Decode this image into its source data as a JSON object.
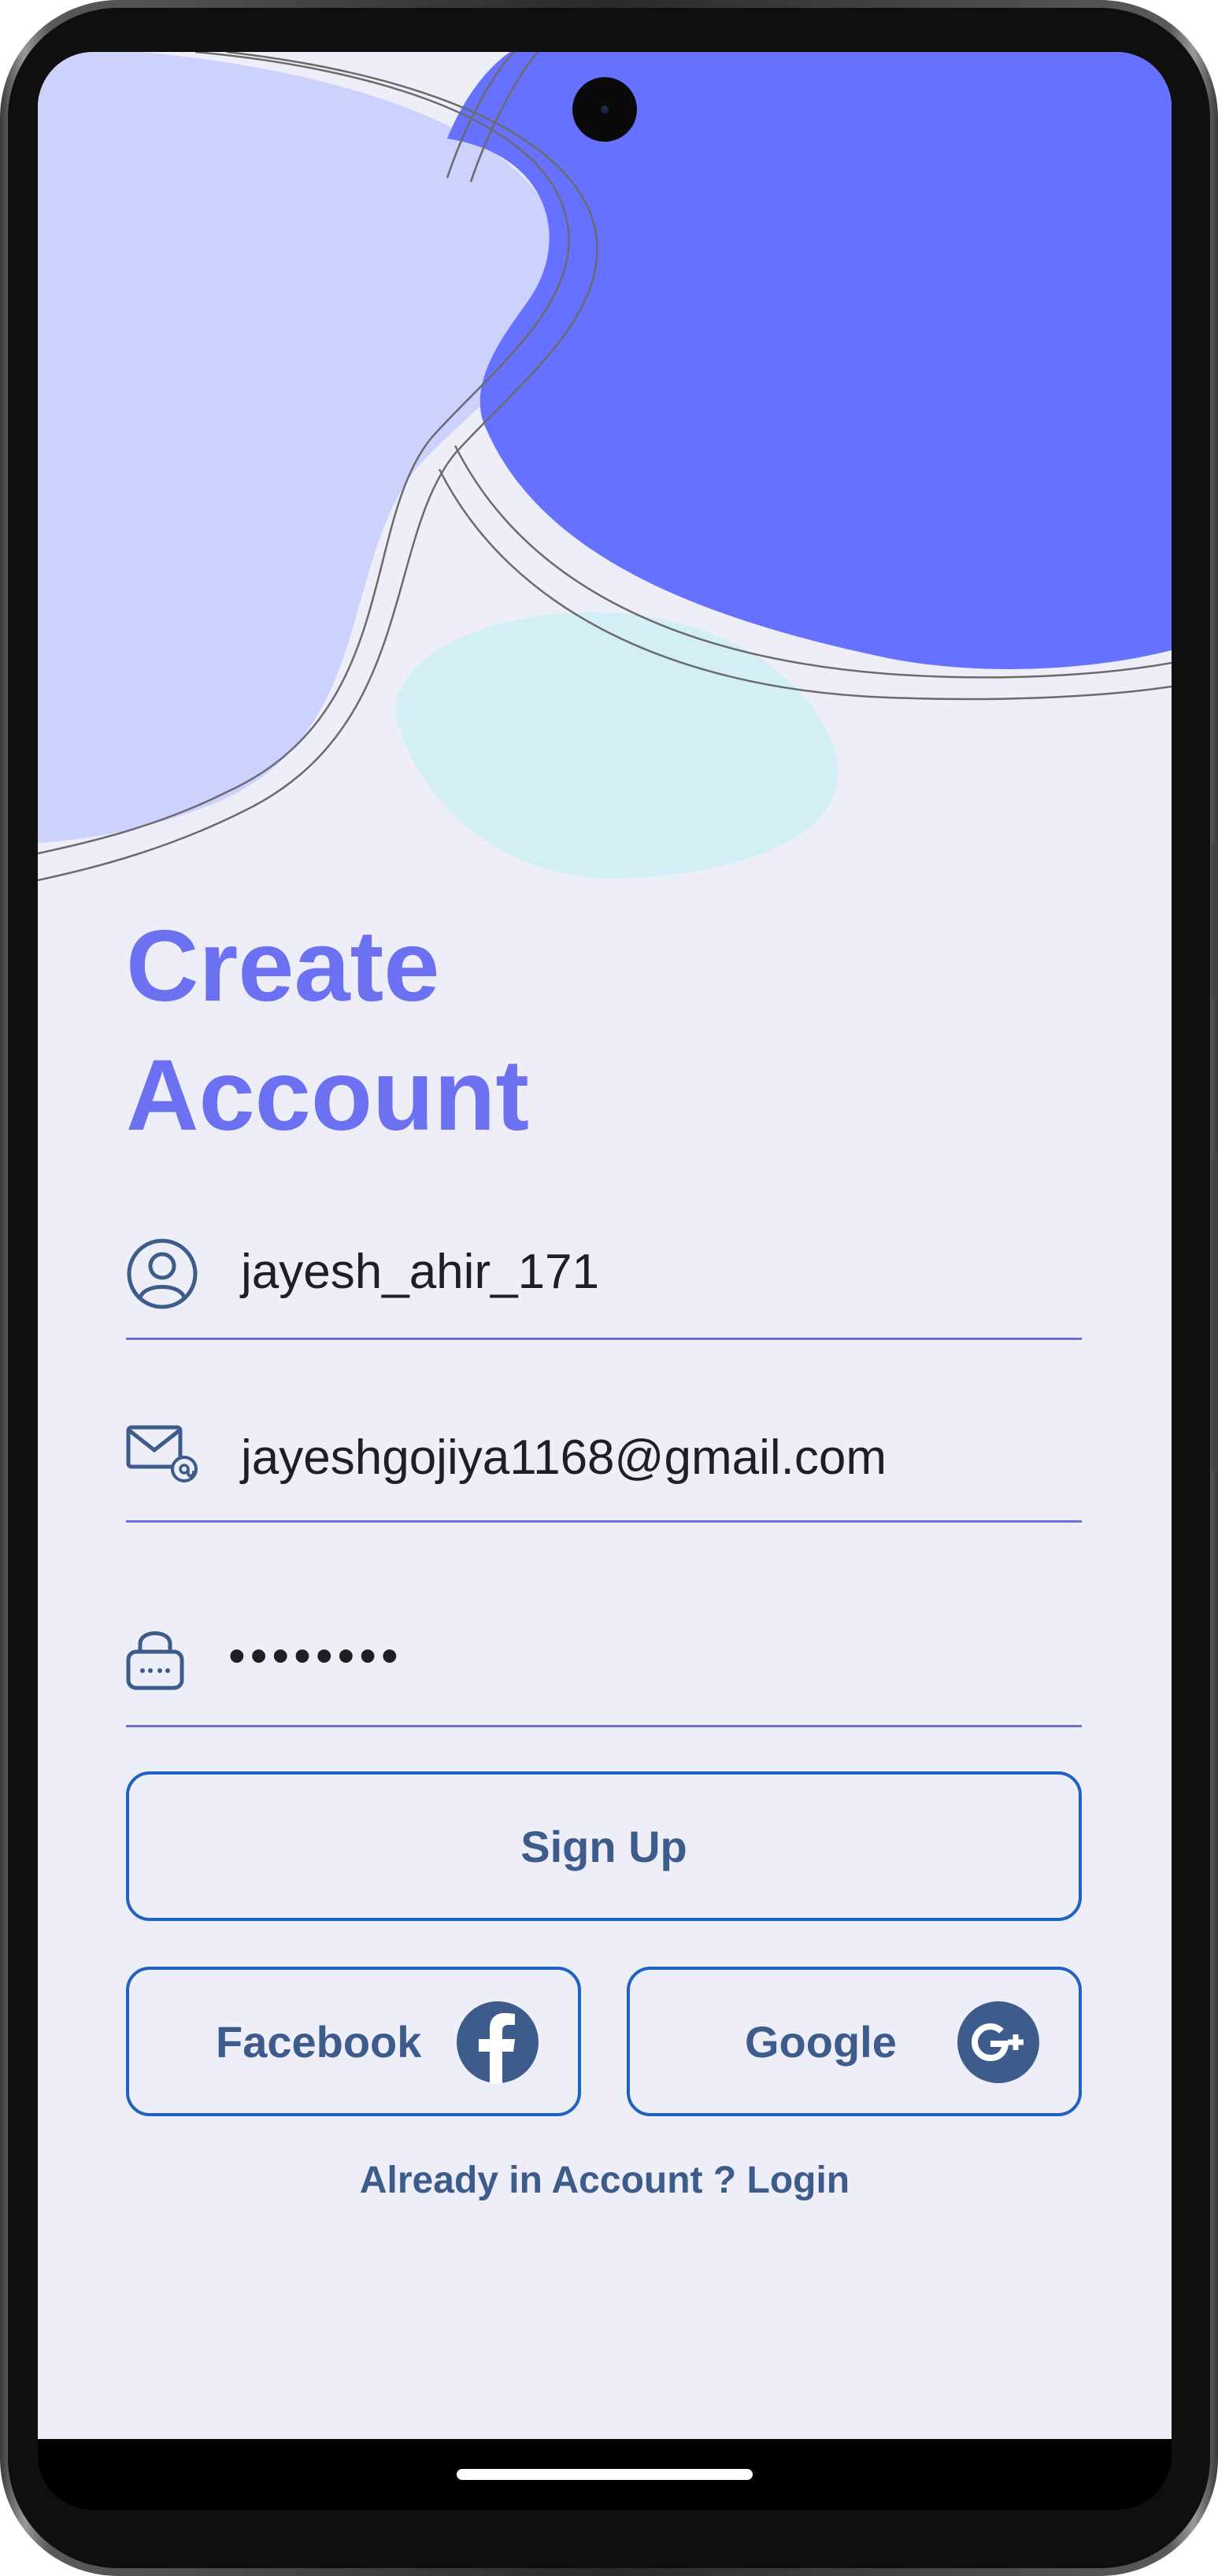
{
  "form": {
    "title_line1": "Create",
    "title_line2": "Account",
    "username_value": "jayesh_ahir_171",
    "email_value": "jayeshgojiya1168@gmail.com",
    "password_value": "••••••••"
  },
  "buttons": {
    "signup_label": "Sign Up",
    "facebook_label": "Facebook",
    "google_label": "Google"
  },
  "footer": {
    "login_link": "Already in Account ? Login"
  },
  "icons": {
    "username": "user-circle-icon",
    "email": "mail-at-icon",
    "password": "lock-icon",
    "facebook": "facebook-icon",
    "google": "google-plus-icon"
  },
  "colors": {
    "background": "#eeeef8",
    "title": "#6b71f0",
    "accent_blob": "#6672ff",
    "light_blob": "#cdd1fd",
    "cyan_blob": "#d3eff6",
    "field_line": "#6a6fd9",
    "button_border": "#1f62c2",
    "button_text": "#3d5c8c"
  }
}
